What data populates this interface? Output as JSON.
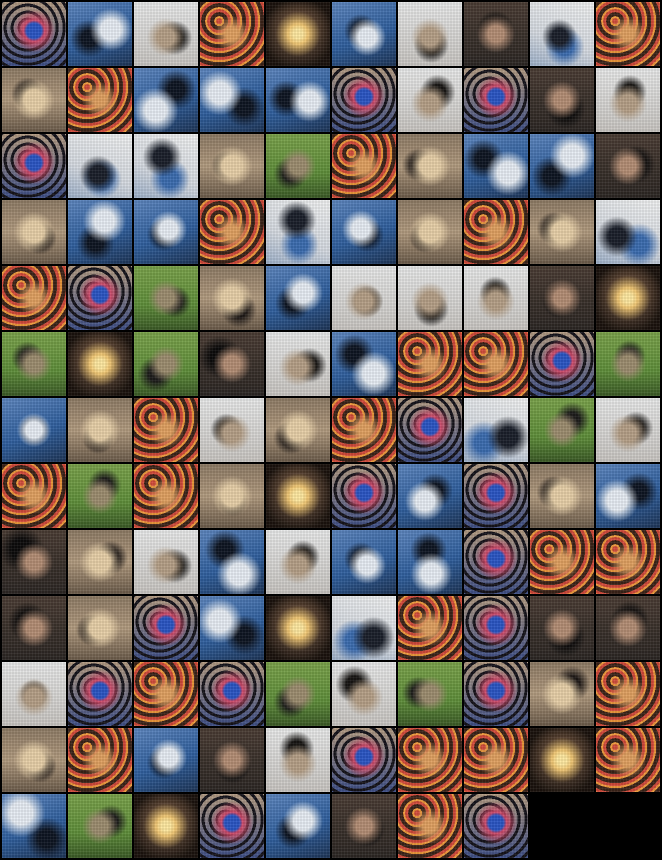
{
  "grid": {
    "columns": 10,
    "total_tiles": 128,
    "background": "#000000"
  },
  "palette": {
    "sky": {
      "bg": "#2f5f9e",
      "fg": "#e8eef5",
      "ac": "#0e1522"
    },
    "cloud": {
      "bg": "#f1f2f2",
      "fg": "#3b6cb0",
      "ac": "#1a1f2a"
    },
    "sand": {
      "bg": "#b29b7f",
      "fg": "#e8d0a8",
      "ac": "#1b1614"
    },
    "sun": {
      "bg": "#3a2c22",
      "fg": "#f4c974",
      "ac": "#1a120d"
    },
    "red": {
      "bg": "#7e3c22",
      "fg": "#d24a3a",
      "ac": "#f09a3c"
    },
    "blue": {
      "bg": "#3e4f87",
      "fg": "#2a55c4",
      "ac": "#d24a6a"
    },
    "green": {
      "bg": "#5f8f3a",
      "fg": "#9c8c6e",
      "ac": "#1c1b1a"
    },
    "dark": {
      "bg": "#2b2623",
      "fg": "#b38d74",
      "ac": "#0c0b0b"
    },
    "white": {
      "bg": "#e9eaea",
      "fg": "#b59f86",
      "ac": "#171513"
    }
  },
  "tiles": [
    "blue",
    "sky",
    "white",
    "red",
    "sun",
    "sky",
    "white",
    "dark",
    "cloud",
    "red",
    "sand",
    "red",
    "sky",
    "sky",
    "sky",
    "blue",
    "white",
    "blue",
    "dark",
    "white",
    "blue",
    "cloud",
    "cloud",
    "sand",
    "green",
    "red",
    "sand",
    "sky",
    "sky",
    "dark",
    "sand",
    "sky",
    "sky",
    "red",
    "cloud",
    "sky",
    "sand",
    "red",
    "sand",
    "cloud",
    "red",
    "blue",
    "green",
    "sand",
    "sky",
    "white",
    "white",
    "white",
    "dark",
    "sun",
    "green",
    "sun",
    "green",
    "dark",
    "white",
    "sky",
    "red",
    "red",
    "blue",
    "green",
    "sky",
    "sand",
    "red",
    "white",
    "sand",
    "red",
    "blue",
    "cloud",
    "green",
    "white",
    "red",
    "green",
    "red",
    "sand",
    "sun",
    "blue",
    "sky",
    "blue",
    "sand",
    "sky",
    "dark",
    "sand",
    "white",
    "sky",
    "white",
    "sky",
    "sky",
    "blue",
    "red",
    "red",
    "dark",
    "sand",
    "blue",
    "sky",
    "sun",
    "cloud",
    "red",
    "blue",
    "dark",
    "dark",
    "white",
    "blue",
    "red",
    "blue",
    "green",
    "white",
    "green",
    "blue",
    "sand",
    "red",
    "sand",
    "red",
    "sky",
    "dark",
    "white",
    "blue",
    "red",
    "red",
    "sun",
    "red",
    "sky",
    "green",
    "sun",
    "blue",
    "sky",
    "dark",
    "red",
    "blue"
  ]
}
